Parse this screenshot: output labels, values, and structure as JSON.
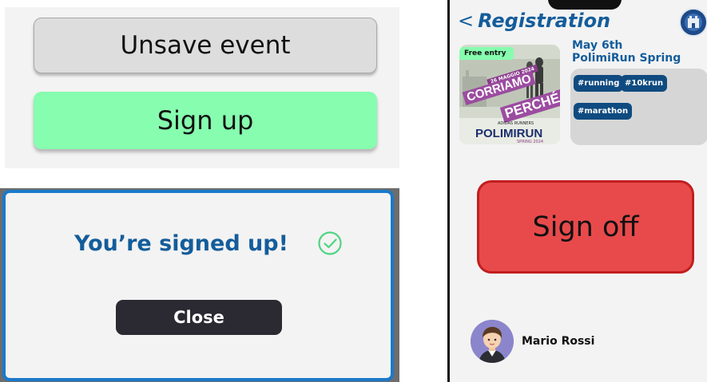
{
  "buttons_panel": {
    "unsave_label": "Unsave event",
    "signup_label": "Sign up",
    "signup_color": "#86fdaf"
  },
  "modal": {
    "title": "You’re signed up!",
    "close_label": "Close",
    "border_color": "#1b79c9",
    "check_color": "#4fd582"
  },
  "phone": {
    "back_chevron": "<",
    "title": "Registration",
    "event": {
      "badge": "Free entry",
      "poster_date": "26 MAGGIO 2024",
      "poster_line1": "CORRIAMO",
      "poster_line2": "PERCHÉ",
      "poster_sub": "ADIDAS RUNNERS",
      "poster_brand": "POLIMIRUN",
      "poster_brand_sub": "SPRING 2024",
      "date": "May 6th",
      "name": "PolimiRun Spring",
      "tags": [
        "#running",
        "#10krun",
        "#marathon"
      ]
    },
    "signoff_label": "Sign off",
    "signoff_color": "#e84a4b",
    "user_name": "Mario Rossi"
  }
}
